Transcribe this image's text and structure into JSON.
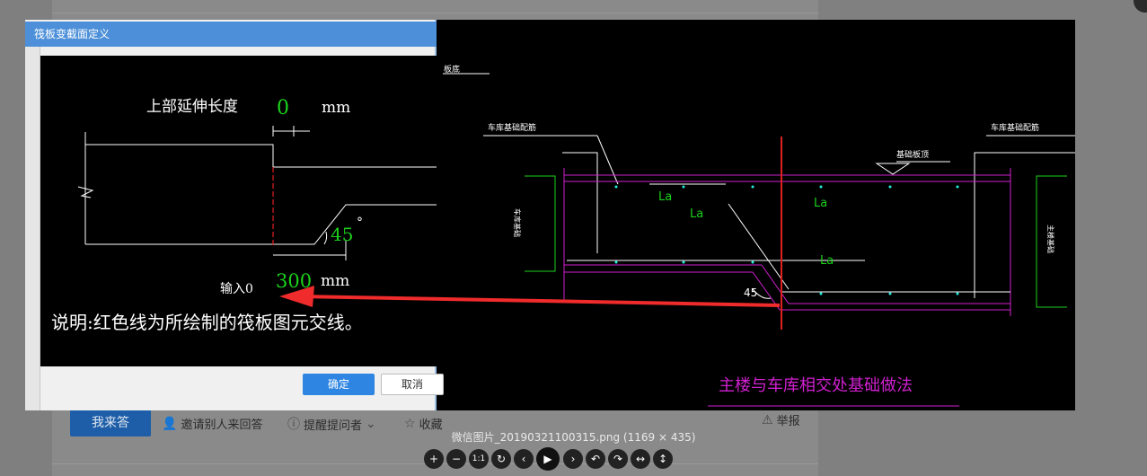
{
  "background": {
    "answer_button": "我来答",
    "invite": "邀请别人来回答",
    "remind": "提醒提问者",
    "favorite": "收藏",
    "report": "举报"
  },
  "dialog": {
    "title": "筏板变截面定义",
    "ok": "确定",
    "cancel": "取消",
    "labels": {
      "top_ext": "上部延伸长度",
      "top_val": "0",
      "top_unit": "mm",
      "angle_val": "45",
      "angle_unit": "°",
      "bottom_val": "300",
      "bottom_unit": "mm",
      "input_hint": "输入0",
      "note": "说明:红色线为所绘制的筏板图元交线。"
    }
  },
  "drawing": {
    "label_top_left": "板底",
    "garage_left": "车库基础配筋",
    "garage_right": "车库基础配筋",
    "foundation_top": "基础板顶",
    "side_left": "车库基础",
    "side_right": "主楼基础",
    "la1": "La",
    "la2": "La",
    "la3": "La",
    "la4": "La",
    "angle": "45",
    "title": "主楼与车库相交处基础做法"
  },
  "viewer": {
    "caption": "微信图片_20190321100315.png (1169 × 435)",
    "tools": [
      "+",
      "−",
      "1:1",
      "↻",
      "‹",
      "▶",
      "›",
      "↶",
      "↷",
      "↔",
      "↕"
    ]
  },
  "colors": {
    "accent": "#4d90d9",
    "green": "#1bd11b",
    "magenta": "#d020d0",
    "red": "#e02020"
  }
}
